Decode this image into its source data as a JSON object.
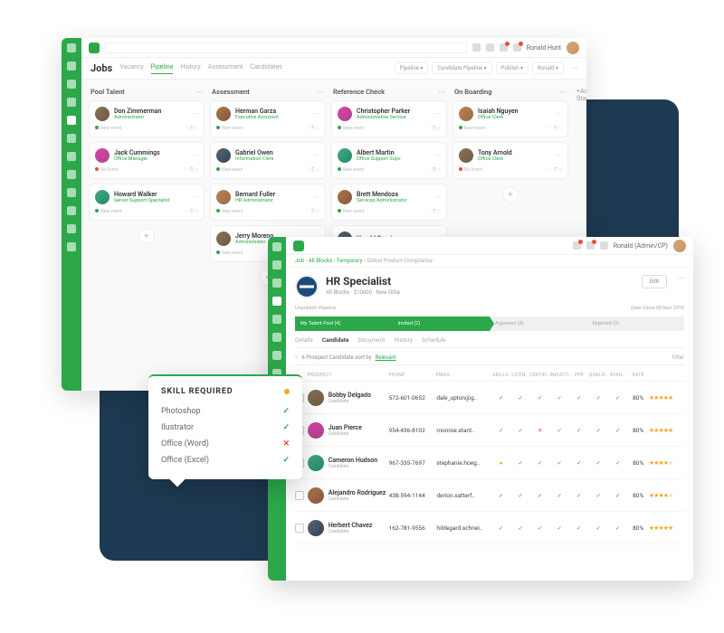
{
  "topbar": {
    "user": "Ronald Hunt"
  },
  "jobs": {
    "title": "Jobs",
    "tabs": [
      "Vacancy",
      "Pipeline",
      "History",
      "Assessment",
      "Candidates"
    ],
    "active": "Pipeline",
    "filters": [
      "Pipeline",
      "Candidate Pipeline",
      "Publish",
      "Ronald"
    ]
  },
  "board": {
    "cols": [
      {
        "name": "Pool Talent",
        "cards": [
          {
            "n": "Don Zimmerman",
            "r": "Administrator",
            "e": "New event",
            "d": "g"
          },
          {
            "n": "Jack Cummings",
            "r": "Office Manager",
            "e": "No Event",
            "d": "r"
          },
          {
            "n": "Howard Walker",
            "r": "Senior Support Specialist",
            "e": "New event",
            "d": "g"
          }
        ]
      },
      {
        "name": "Assessment",
        "cards": [
          {
            "n": "Herman Garza",
            "r": "Executive Assistant",
            "e": "New event",
            "d": "g"
          },
          {
            "n": "Gabriel Owen",
            "r": "Information Clerk",
            "e": "New event",
            "d": "g"
          },
          {
            "n": "Bernard Fuller",
            "r": "HR Administrator",
            "e": "New event",
            "d": "g"
          },
          {
            "n": "Jerry Moreno",
            "r": "Administrator",
            "e": "New event",
            "d": "g"
          }
        ]
      },
      {
        "name": "Reference Check",
        "cards": [
          {
            "n": "Christopher Parker",
            "r": "Administrative Service",
            "e": "New event",
            "d": "g"
          },
          {
            "n": "Albert Martin",
            "r": "Office Support Supv.",
            "e": "New event",
            "d": "g"
          },
          {
            "n": "Brett Mendoza",
            "r": "Services Administrator",
            "e": "New event",
            "d": "g"
          },
          {
            "n": "Harold Garcia",
            "r": "",
            "e": "",
            "d": "g"
          }
        ]
      },
      {
        "name": "On Boarding",
        "cards": [
          {
            "n": "Isaiah Nguyen",
            "r": "Office Clerk",
            "e": "New event",
            "d": "g"
          },
          {
            "n": "Tony Arnold",
            "r": "Office Clerk",
            "e": "No Event",
            "d": "r"
          }
        ]
      }
    ],
    "add": "+Add Stage"
  },
  "win2": {
    "user": "Ronald (Admin/CP)",
    "crumbs": [
      "Job",
      "All Blocks",
      "Temporary",
      "Global Product Compliance"
    ],
    "jobtitle": "HR Specialist",
    "jobmeta": "All Blocks · $10000 · New Orba",
    "unpub": "Unpublish Pipeline",
    "closedate": "Date Close 08 Nov 2018",
    "pipeline": [
      "My Talent Pool (4)",
      "Invited (2)",
      "Approved (0)",
      "Rejected (0)"
    ],
    "tabs": [
      "Details",
      "Candidate",
      "Document",
      "History",
      "Schedule"
    ],
    "active": "Candidate",
    "searchtext": "6 Prospect Candidate sort by",
    "rel": "Relevant",
    "filter": "Filter",
    "thead": [
      "PROSPECT",
      "PHONE",
      "EMAIL",
      "SKILLS",
      "LICEN..",
      "CERTIFI..",
      "INDUCTI..",
      "PPE",
      "QUALIF..",
      "AVAIL..",
      "RATE"
    ],
    "rows": [
      {
        "n": "Bobby Delgado",
        "r": "Candidate",
        "ph": "572-601-0652",
        "em": "dale_upton@g..",
        "m": [
          "y",
          "y",
          "y",
          "y",
          "y",
          "y",
          "y"
        ],
        "rt": "80%",
        "st": 5
      },
      {
        "n": "Juan Pierce",
        "r": "Candidate",
        "ph": "954-436-8102",
        "em": "monroe.stant..",
        "m": [
          "y",
          "y",
          "n",
          "y",
          "y",
          "y",
          "y"
        ],
        "rt": "80%",
        "st": 5
      },
      {
        "n": "Cameron Hudson",
        "r": "Candidate",
        "ph": "967-335-7697",
        "em": "stephanie.hoeg..",
        "m": [
          "w",
          "y",
          "y",
          "y",
          "y",
          "y",
          "y"
        ],
        "rt": "80%",
        "st": 4
      },
      {
        "n": "Alejandro Rodriguez",
        "r": "Candidate",
        "ph": "438-594-1144",
        "em": "derion.satterf..",
        "m": [
          "y",
          "y",
          "y",
          "y",
          "y",
          "y",
          "y"
        ],
        "rt": "80%",
        "st": 4
      },
      {
        "n": "Herbert Chavez",
        "r": "Candidate",
        "ph": "162-781-9556",
        "em": "hildegard.schnei..",
        "m": [
          "y",
          "y",
          "y",
          "y",
          "y",
          "y",
          "y"
        ],
        "rt": "80%",
        "st": 5
      }
    ]
  },
  "popup": {
    "title": "SKILL REQUIRED",
    "skills": [
      {
        "n": "Photoshop",
        "ok": true
      },
      {
        "n": "Ilustrator",
        "ok": true
      },
      {
        "n": "Office (Word)",
        "ok": false
      },
      {
        "n": "Office (Excel)",
        "ok": true
      }
    ]
  }
}
